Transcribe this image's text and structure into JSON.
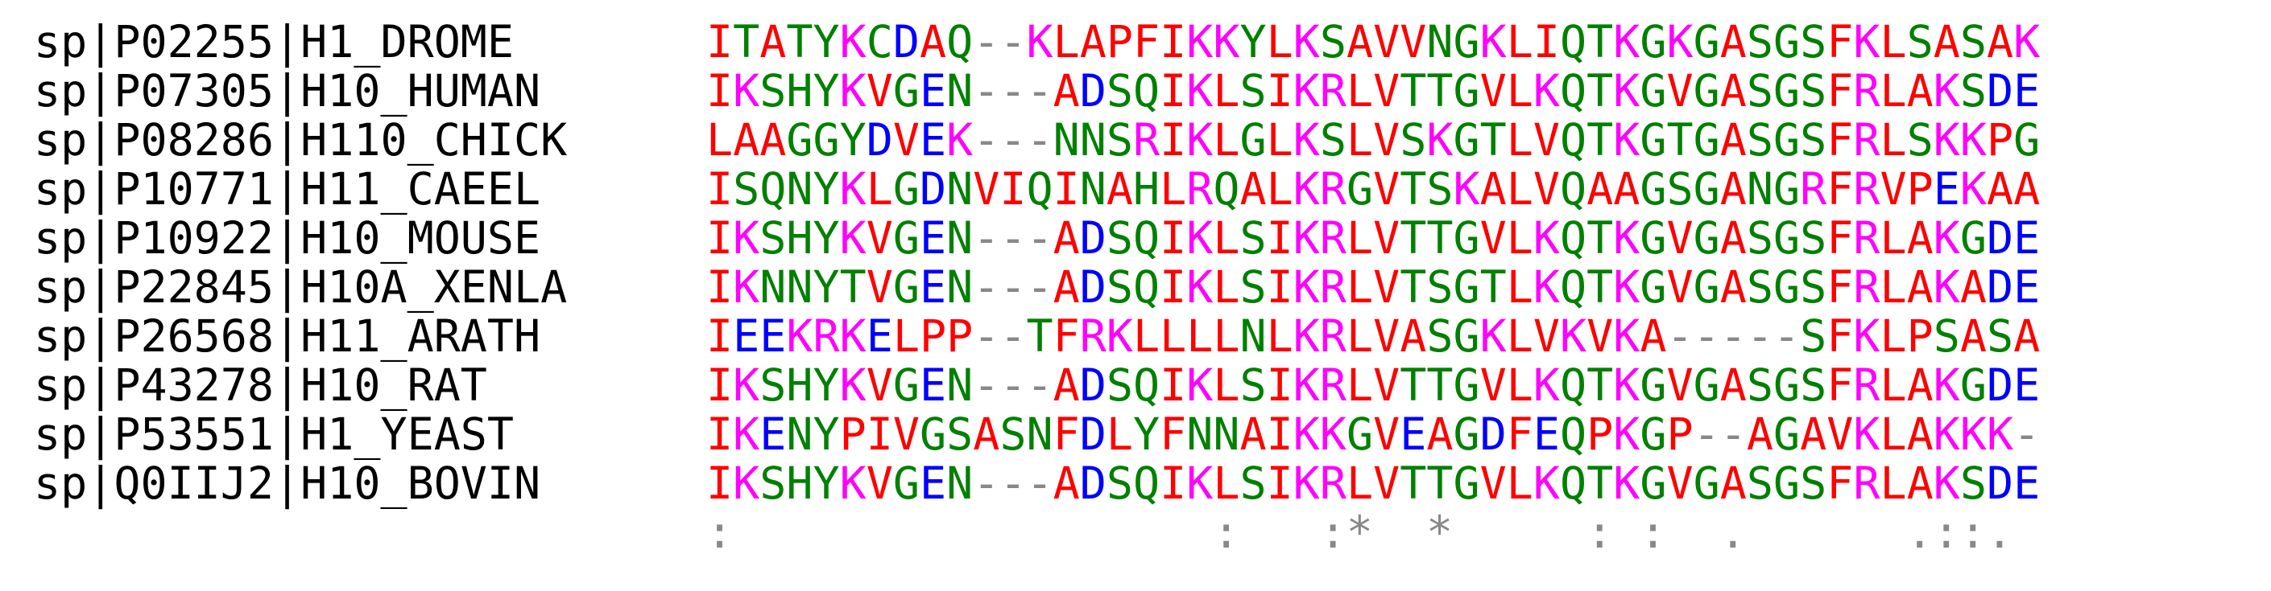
{
  "alignment": {
    "rows": [
      {
        "label": "sp|P02255|H1_DROME",
        "sequence": "ITATYKCDAQ--KLAPFIKKYLKSAVVNGKLIQTKGKGASGSFKLSASAK"
      },
      {
        "label": "sp|P07305|H10_HUMAN",
        "sequence": "IKSHYKVGEN---ADSQIKLSIKRLVTTGVLKQTKGVGASGSFRLAKSDE"
      },
      {
        "label": "sp|P08286|H110_CHICK",
        "sequence": "LAAGGYDVEK---NNSRIKLGLKSLVSKGTLVQTKGTGASGSFRLSKKPG"
      },
      {
        "label": "sp|P10771|H11_CAEEL",
        "sequence": "ISQNYKLGDNVIQINAHLRQALKRGVTSKALVQAAGSGANGRFRVPEKAA"
      },
      {
        "label": "sp|P10922|H10_MOUSE",
        "sequence": "IKSHYKVGEN---ADSQIKLSIKRLVTTGVLKQTKGVGASGSFRLAKGDE"
      },
      {
        "label": "sp|P22845|H10A_XENLA",
        "sequence": "IKNNYTVGEN---ADSQIKLSIKRLVTSGTLKQTKGVGASGSFRLAKADE"
      },
      {
        "label": "sp|P26568|H11_ARATH",
        "sequence": "IEEKRKELPP--TFRKLLLLNLKRLVASGKLVKVKA-----SFKLPSASA"
      },
      {
        "label": "sp|P43278|H10_RAT",
        "sequence": "IKSHYKVGEN---ADSQIKLSIKRLVTTGVLKQTKGVGASGSFRLAKGDE"
      },
      {
        "label": "sp|P53551|H1_YEAST",
        "sequence": "IKENYPIVGSASNFDLYFNNAIKKGVEAGDFEQPKGP--AGAVKLAKKK-"
      },
      {
        "label": "sp|Q0IIJ2|H10_BOVIN",
        "sequence": "IKSHYKVGEN---ADSQIKLSIKRLVTTGVLKQTKGVGASGSFRLAKSDE"
      }
    ],
    "consensus": ":                  :   :*  *     : :  .      .::.  "
  },
  "colors": {
    "hydrophobic_small": "#ff0000",
    "acidic": "#0000ff",
    "basic": "#ff00ff",
    "polar": "#008000",
    "gap": "#888888",
    "label": "#000000",
    "consensus": "#888888"
  }
}
